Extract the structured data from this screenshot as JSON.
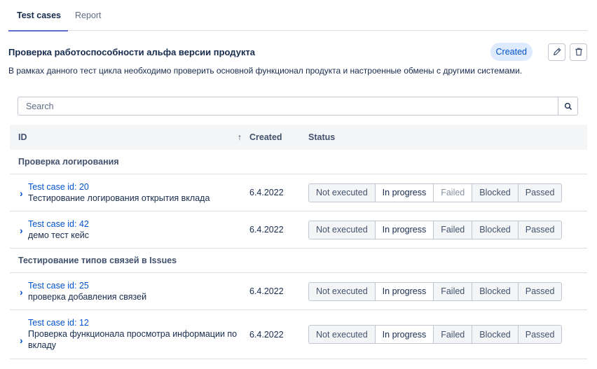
{
  "tabs": [
    {
      "label": "Test cases"
    },
    {
      "label": "Report"
    }
  ],
  "header": {
    "title": "Проверка работоспособности альфа версии продукта",
    "status": "Created",
    "description": "В рамках данного тест цикла необходимо проверить основной функционал продукта и настроенные обмены с другими системами."
  },
  "search": {
    "placeholder": "Search"
  },
  "table": {
    "columns": {
      "id": "ID",
      "sort": "↑",
      "created": "Created",
      "status": "Status"
    },
    "status_options": [
      "Not executed",
      "In progress",
      "Failed",
      "Blocked",
      "Passed"
    ],
    "groups": [
      {
        "name": "Проверка логирования",
        "cases": [
          {
            "id": "Test case id: 20",
            "description": "Тестирование логирования открытия вклада",
            "created": "6.4.2022",
            "status": "In progress"
          },
          {
            "id": "Test case id: 42",
            "description": "демо тест кейс",
            "created": "6.4.2022",
            "status": "In progress"
          }
        ]
      },
      {
        "name": "Тестирование типов связей в Issues",
        "cases": [
          {
            "id": "Test case id: 25",
            "description": "проверка добавления связей",
            "created": "6.4.2022",
            "status": "In progress"
          },
          {
            "id": "Test case id: 12",
            "description": "Проверка функционала просмотра информации по вкладу",
            "created": "6.4.2022",
            "status": "In progress"
          }
        ]
      }
    ]
  },
  "colors": {
    "accent": "#0052cc",
    "tab_underline": "#5a6fd0",
    "badge_bg": "#deebff"
  },
  "icons": {
    "edit": "pencil-icon",
    "delete": "trash-icon",
    "search": "search-icon",
    "expand": "chevron-right-icon"
  }
}
